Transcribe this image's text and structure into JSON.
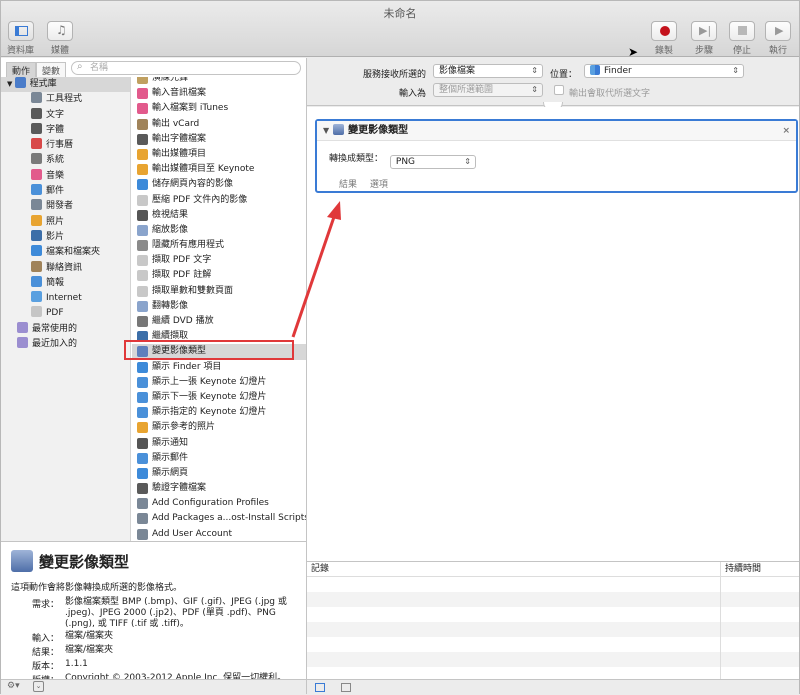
{
  "window": {
    "title": "未命名"
  },
  "toolbar": {
    "left": [
      {
        "label": "資料庫",
        "icon": "library-icon"
      },
      {
        "label": "媒體",
        "icon": "media-icon"
      }
    ],
    "right": [
      {
        "label": "錄製",
        "icon": "record-icon"
      },
      {
        "label": "步驟",
        "icon": "step-icon"
      },
      {
        "label": "停止",
        "icon": "stop-icon"
      },
      {
        "label": "執行",
        "icon": "run-icon"
      }
    ]
  },
  "search": {
    "tab_actions": "動作",
    "tab_variables": "變數",
    "placeholder": "名稱"
  },
  "library": [
    {
      "label": "程式庫",
      "level": 0,
      "color": "#4a7cc9"
    },
    {
      "label": "工具程式",
      "level": 1,
      "color": "#7a8796"
    },
    {
      "label": "文字",
      "level": 1,
      "color": "#5a5a5a"
    },
    {
      "label": "字體",
      "level": 1,
      "color": "#5a5a5a"
    },
    {
      "label": "行事曆",
      "level": 1,
      "color": "#d84848"
    },
    {
      "label": "系統",
      "level": 1,
      "color": "#7a7a7a"
    },
    {
      "label": "音樂",
      "level": 1,
      "color": "#e25a8c"
    },
    {
      "label": "郵件",
      "level": 1,
      "color": "#4a90d9"
    },
    {
      "label": "開發者",
      "level": 1,
      "color": "#7a8796"
    },
    {
      "label": "照片",
      "level": 1,
      "color": "#e8a431"
    },
    {
      "label": "影片",
      "level": 1,
      "color": "#3c6ea8"
    },
    {
      "label": "檔案和檔案夾",
      "level": 1,
      "color": "#3d8ad9"
    },
    {
      "label": "聯絡資訊",
      "level": 1,
      "color": "#a0835a"
    },
    {
      "label": "簡報",
      "level": 1,
      "color": "#4a90d9"
    },
    {
      "label": "Internet",
      "level": 1,
      "color": "#5aa0e0"
    },
    {
      "label": "PDF",
      "level": 1,
      "color": "#c5c5c5"
    },
    {
      "label": "最常使用的",
      "level": 2,
      "color": "#9b8ed0"
    },
    {
      "label": "最近加入的",
      "level": 2,
      "color": "#9b8ed0"
    }
  ],
  "actions": [
    {
      "label": "演練先鋒",
      "color": "#c0a060"
    },
    {
      "label": "輸入音訊檔案",
      "color": "#e25a8c"
    },
    {
      "label": "輸入檔案到 iTunes",
      "color": "#e25a8c"
    },
    {
      "label": "輸出 vCard",
      "color": "#a0835a"
    },
    {
      "label": "輸出字體檔案",
      "color": "#5a5a5a"
    },
    {
      "label": "輸出媒體項目",
      "color": "#e8a431"
    },
    {
      "label": "輸出媒體項目至 Keynote",
      "color": "#e8a431"
    },
    {
      "label": "儲存網頁內容的影像",
      "color": "#3d8ad9"
    },
    {
      "label": "壓縮 PDF 文件內的影像",
      "color": "#c8c8c8"
    },
    {
      "label": "檢視結果",
      "color": "#555555"
    },
    {
      "label": "縮放影像",
      "color": "#8aa4cc"
    },
    {
      "label": "隱藏所有應用程式",
      "color": "#8a8a8a"
    },
    {
      "label": "擷取 PDF 文字",
      "color": "#c8c8c8"
    },
    {
      "label": "擷取 PDF 註解",
      "color": "#c8c8c8"
    },
    {
      "label": "擷取單數和雙數頁面",
      "color": "#c8c8c8"
    },
    {
      "label": "翻轉影像",
      "color": "#8aa4cc"
    },
    {
      "label": "繼續 DVD 播放",
      "color": "#777777"
    },
    {
      "label": "繼續擷取",
      "color": "#3c6ea8"
    },
    {
      "label": "變更影像類型",
      "color": "#5e80bc"
    },
    {
      "label": "顯示 Finder 項目",
      "color": "#3d8ad9"
    },
    {
      "label": "顯示上一張 Keynote 幻燈片",
      "color": "#4a90d9"
    },
    {
      "label": "顯示下一張 Keynote 幻燈片",
      "color": "#4a90d9"
    },
    {
      "label": "顯示指定的 Keynote 幻燈片",
      "color": "#4a90d9"
    },
    {
      "label": "顯示參考的照片",
      "color": "#e8a431"
    },
    {
      "label": "顯示通知",
      "color": "#555555"
    },
    {
      "label": "顯示郵件",
      "color": "#4a90d9"
    },
    {
      "label": "顯示網頁",
      "color": "#3d8ad9"
    },
    {
      "label": "驗證字體檔案",
      "color": "#5a5a5a"
    },
    {
      "label": "Add Configuration Profiles",
      "color": "#7a8796"
    },
    {
      "label": "Add Packages a...ost-Install Scripts",
      "color": "#7a8796"
    },
    {
      "label": "Add User Account",
      "color": "#7a8796"
    }
  ],
  "selected_action_index": 18,
  "description": {
    "title": "變更影像類型",
    "summary": "這項動作會將影像轉換成所選的影像格式。",
    "rows": [
      {
        "k": "需求：",
        "v": "影像檔案類型 BMP (.bmp)、GIF (.gif)、JPEG (.jpg 或 .jpeg)、JPEG 2000 (.jp2)、PDF (單頁 .pdf)、PNG (.png), 或 TIFF (.tif 或 .tiff)。"
      },
      {
        "k": "輸入：",
        "v": "檔案/檔案夾"
      },
      {
        "k": "結果：",
        "v": "檔案/檔案夾"
      },
      {
        "k": "版本：",
        "v": "1.1.1"
      },
      {
        "k": "版權：",
        "v": "Copyright © 2003-2012 Apple Inc. 保留一切權利。"
      }
    ]
  },
  "service": {
    "receives_label": "服務接收所選的",
    "receives_value": "影像檔案",
    "location_label": "位置：",
    "location_value": "Finder",
    "input_label": "輸入為",
    "input_value": "整個所選範圍",
    "replace_label": "輸出會取代所選文字"
  },
  "action_card": {
    "title": "變更影像類型",
    "field_label": "轉換成類型：",
    "field_value": "PNG",
    "tab_results": "結果",
    "tab_options": "選項",
    "close": "×"
  },
  "log": {
    "col_log": "記錄",
    "col_duration": "持續時間"
  },
  "colors": {
    "accent": "#3a7bd5",
    "annotation": "#e0383a"
  }
}
